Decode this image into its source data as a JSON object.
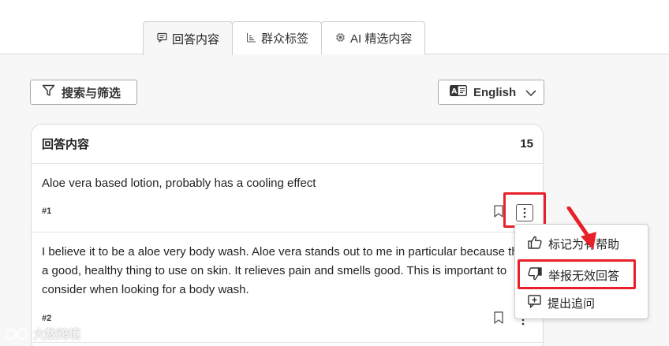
{
  "tabs": [
    {
      "label": "回答内容",
      "icon": "chat-icon",
      "active": true
    },
    {
      "label": "群众标签",
      "icon": "bar-chart-icon",
      "active": false
    },
    {
      "label": "AI 精选内容",
      "icon": "ai-chip-icon",
      "active": false
    }
  ],
  "toolbar": {
    "filter_label": "搜索与筛选",
    "language_label": "English"
  },
  "answers_panel": {
    "title": "回答内容",
    "count": "15",
    "items": [
      {
        "text": "Aloe vera based lotion, probably has a cooling effect",
        "number": "#1"
      },
      {
        "lines": [
          "I believe it to be a aloe very body wash. Aloe vera stands out to me in particular because th",
          "a good, healthy thing to use on skin. It relieves pain and smells good. This is important to",
          "consider when looking for a body wash."
        ],
        "number": "#2"
      }
    ]
  },
  "context_menu": {
    "items": [
      {
        "label": "标记为有帮助",
        "icon": "thumbs-up-icon"
      },
      {
        "label": "举报无效回答",
        "icon": "thumbs-down-icon"
      },
      {
        "label": "提出追问",
        "icon": "add-comment-icon"
      }
    ]
  },
  "annotation_color": "#e8202a",
  "watermark": "大数跨境"
}
